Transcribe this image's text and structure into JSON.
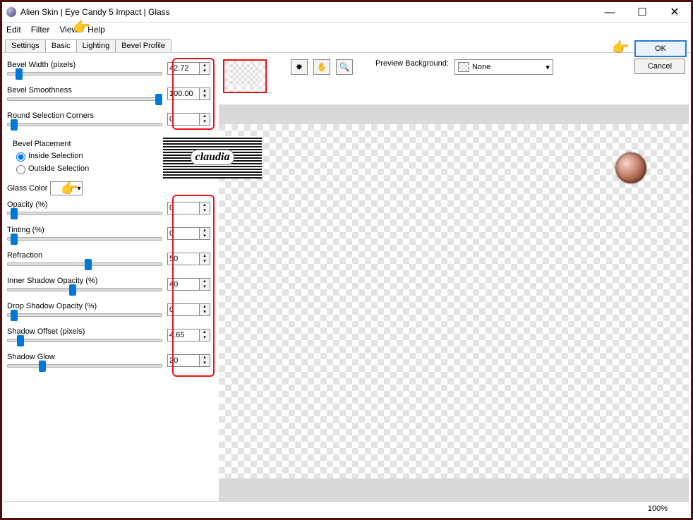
{
  "window": {
    "title": "Alien Skin | Eye Candy 5 Impact | Glass"
  },
  "menu": {
    "edit": "Edit",
    "filter": "Filter",
    "view": "View",
    "help": "Help"
  },
  "tabs": {
    "settings": "Settings",
    "basic": "Basic",
    "lighting": "Lighting",
    "bevel_profile": "Bevel Profile"
  },
  "actions": {
    "ok": "OK",
    "cancel": "Cancel"
  },
  "preview": {
    "label": "Preview Background:",
    "value": "None"
  },
  "status": {
    "zoom": "100%"
  },
  "watermark": {
    "text": "claudia"
  },
  "controls": {
    "bevel_width": {
      "label": "Bevel Width (pixels)",
      "value": "42.72",
      "thumb": 5
    },
    "bevel_smoothness": {
      "label": "Bevel Smoothness",
      "value": "100.00",
      "thumb": 96
    },
    "round_corners": {
      "label": "Round Selection Corners",
      "value": "0",
      "thumb": 2
    },
    "bevel_placement_label": "Bevel Placement",
    "inside": "Inside Selection",
    "outside": "Outside Selection",
    "glass_color_label": "Glass Color",
    "opacity": {
      "label": "Opacity (%)",
      "value": "0",
      "thumb": 2
    },
    "tinting": {
      "label": "Tinting (%)",
      "value": "0",
      "thumb": 2
    },
    "refraction": {
      "label": "Refraction",
      "value": "50",
      "thumb": 50
    },
    "inner_shadow": {
      "label": "Inner Shadow Opacity (%)",
      "value": "40",
      "thumb": 40
    },
    "drop_shadow": {
      "label": "Drop Shadow Opacity (%)",
      "value": "0",
      "thumb": 2
    },
    "shadow_offset": {
      "label": "Shadow Offset (pixels)",
      "value": "4.65",
      "thumb": 6
    },
    "shadow_glow": {
      "label": "Shadow Glow",
      "value": "20",
      "thumb": 20
    }
  }
}
